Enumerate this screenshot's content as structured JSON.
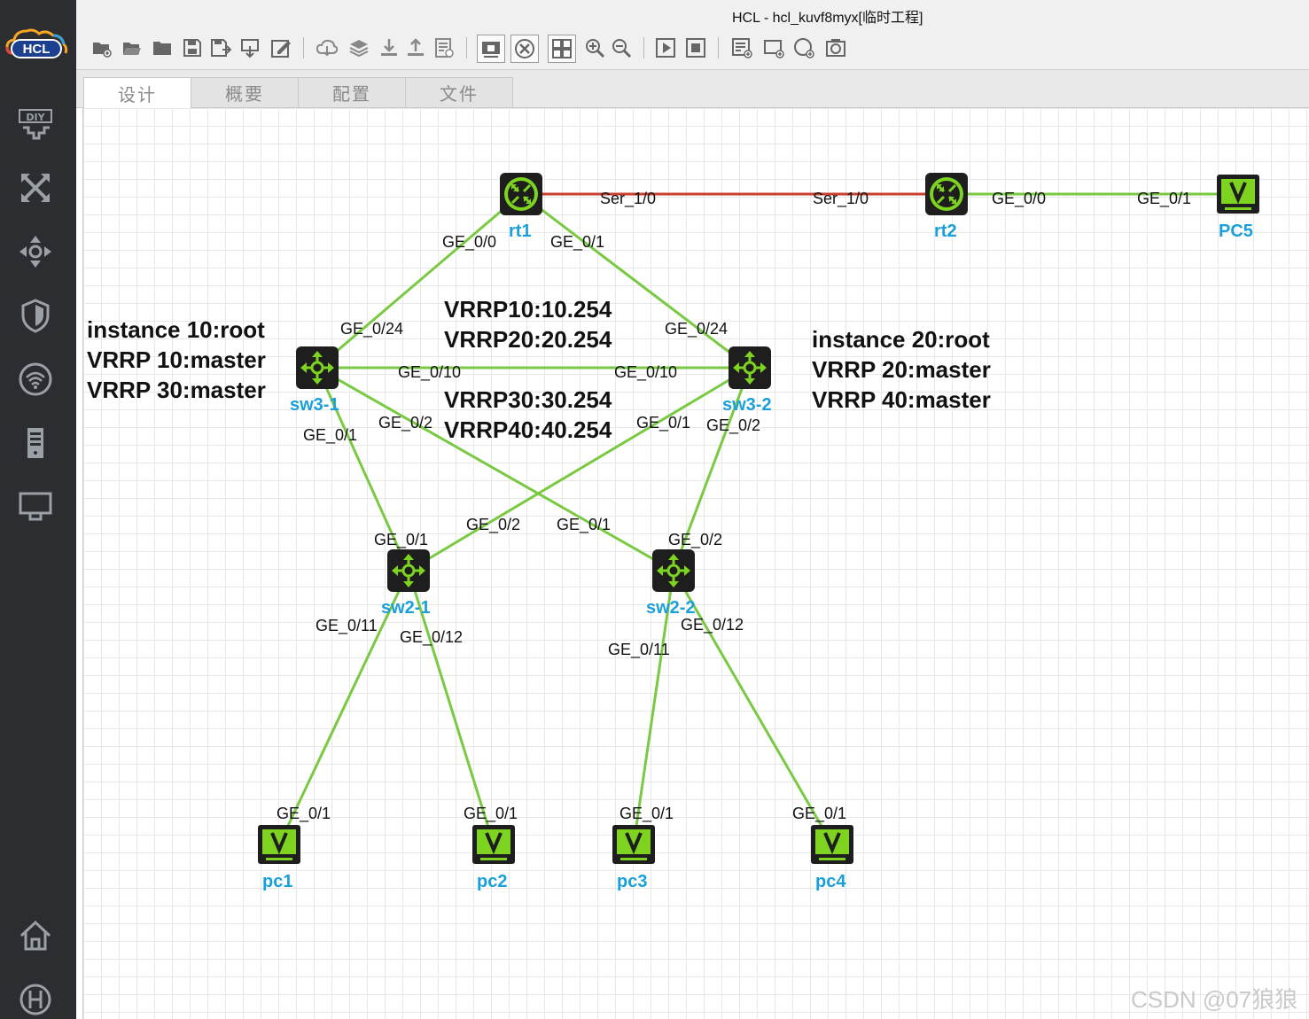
{
  "app": {
    "logo_text": "HCL",
    "title": "HCL - hcl_kuvf8myx[临时工程]"
  },
  "sidebar": {
    "items": [
      {
        "icon": "diy-icon"
      },
      {
        "icon": "topology-icon"
      },
      {
        "icon": "switch-icon"
      },
      {
        "icon": "shield-icon"
      },
      {
        "icon": "wifi-icon"
      },
      {
        "icon": "server-icon"
      },
      {
        "icon": "terminal-icon"
      },
      {
        "icon": "home-icon"
      },
      {
        "icon": "h-logo-icon"
      }
    ]
  },
  "toolbar": {
    "buttons": [
      "new-project",
      "open-project",
      "open-folder",
      "save",
      "save-as",
      "import",
      "edit",
      "cloud",
      "layers",
      "download",
      "upload",
      "log",
      "capture-window",
      "topology-view",
      "grid-view",
      "zoom-in",
      "zoom-out",
      "start-all",
      "stop-all",
      "add-note",
      "add-rectangle",
      "add-ellipse",
      "screenshot"
    ]
  },
  "tabs": [
    {
      "label": "设计",
      "active": true
    },
    {
      "label": "概要",
      "active": false
    },
    {
      "label": "配置",
      "active": false
    },
    {
      "label": "文件",
      "active": false
    }
  ],
  "devices": {
    "rt1": {
      "label": "rt1",
      "type": "router"
    },
    "rt2": {
      "label": "rt2",
      "type": "router"
    },
    "pc5": {
      "label": "PC5",
      "type": "pc"
    },
    "sw31": {
      "label": "sw3-1",
      "type": "switch"
    },
    "sw32": {
      "label": "sw3-2",
      "type": "switch"
    },
    "sw21": {
      "label": "sw2-1",
      "type": "switch"
    },
    "sw22": {
      "label": "sw2-2",
      "type": "switch"
    },
    "pc1": {
      "label": "pc1",
      "type": "pc"
    },
    "pc2": {
      "label": "pc2",
      "type": "pc"
    },
    "pc3": {
      "label": "pc3",
      "type": "pc"
    },
    "pc4": {
      "label": "pc4",
      "type": "pc"
    }
  },
  "links": [
    {
      "a": "rt1",
      "b": "rt2",
      "kind": "serial"
    },
    {
      "a": "rt2",
      "b": "pc5",
      "kind": "ethernet"
    },
    {
      "a": "rt1",
      "b": "sw31",
      "kind": "ethernet"
    },
    {
      "a": "rt1",
      "b": "sw32",
      "kind": "ethernet"
    },
    {
      "a": "sw31",
      "b": "sw32",
      "kind": "ethernet"
    },
    {
      "a": "sw31",
      "b": "sw21",
      "kind": "ethernet"
    },
    {
      "a": "sw31",
      "b": "sw22",
      "kind": "ethernet"
    },
    {
      "a": "sw32",
      "b": "sw21",
      "kind": "ethernet"
    },
    {
      "a": "sw32",
      "b": "sw22",
      "kind": "ethernet"
    },
    {
      "a": "sw21",
      "b": "pc1",
      "kind": "ethernet"
    },
    {
      "a": "sw21",
      "b": "pc2",
      "kind": "ethernet"
    },
    {
      "a": "sw22",
      "b": "pc3",
      "kind": "ethernet"
    },
    {
      "a": "sw22",
      "b": "pc4",
      "kind": "ethernet"
    }
  ],
  "link_colors": {
    "ethernet": "#7ac943",
    "serial": "#c9412e"
  },
  "ports": {
    "rt1_ser": "Ser_1/0",
    "rt2_ser": "Ser_1/0",
    "rt2_ge00": "GE_0/0",
    "pc5_ge01": "GE_0/1",
    "rt1_ge00": "GE_0/0",
    "rt1_ge01": "GE_0/1",
    "sw31_ge024": "GE_0/24",
    "sw32_ge024": "GE_0/24",
    "sw31_ge010": "GE_0/10",
    "sw32_ge010": "GE_0/10",
    "sw31_ge02": "GE_0/2",
    "sw31_ge01": "GE_0/1",
    "sw32_ge01": "GE_0/1",
    "sw32_ge02": "GE_0/2",
    "sw21_ge01": "GE_0/1",
    "sw21_ge02": "GE_0/2",
    "sw22_ge01": "GE_0/1",
    "sw22_ge02": "GE_0/2",
    "sw21_ge011": "GE_0/11",
    "sw21_ge012": "GE_0/12",
    "sw22_ge011": "GE_0/11",
    "sw22_ge012": "GE_0/12",
    "pc1_ge01": "GE_0/1",
    "pc2_ge01": "GE_0/1",
    "pc3_ge01": "GE_0/1",
    "pc4_ge01": "GE_0/1"
  },
  "notes": {
    "left": [
      "instance 10:root",
      "VRRP 10:master",
      "VRRP 30:master"
    ],
    "center_top": [
      "VRRP10:10.254",
      "VRRP20:20.254"
    ],
    "center_bottom": [
      "VRRP30:30.254",
      "VRRP40:40.254"
    ],
    "right": [
      "instance 20:root",
      "VRRP 20:master",
      "VRRP 40:master"
    ]
  },
  "watermark": "CSDN @07狼狼",
  "colors": {
    "device_green": "#7ed321",
    "device_label": "#1aa0d8",
    "sidebar_bg": "#2b2d31"
  }
}
